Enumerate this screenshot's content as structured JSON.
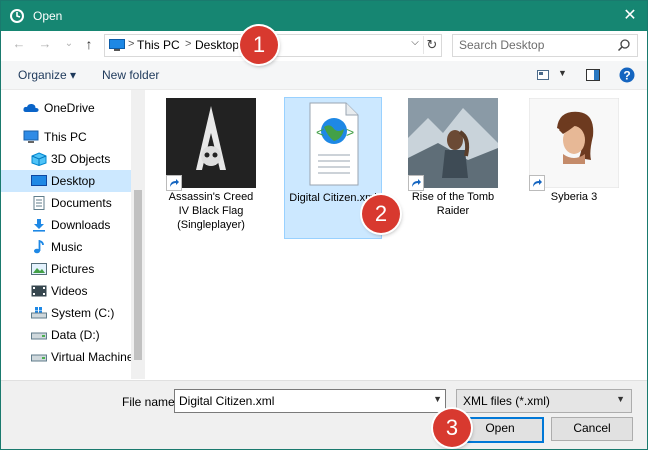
{
  "window": {
    "title": "Open",
    "close_glyph": "✕"
  },
  "nav_buttons": {
    "back": "←",
    "forward": "→",
    "recent": "⌄",
    "up": "↑"
  },
  "address": {
    "crumbs": [
      "This PC",
      "Desktop"
    ],
    "separator": ">",
    "dropdown": "⌵",
    "refresh": "↻"
  },
  "search": {
    "placeholder": "Search Desktop"
  },
  "toolbar": {
    "organize_label": "Organize ▾",
    "new_folder_label": "New folder",
    "view_dropdown": "▼"
  },
  "nav_pane": {
    "items": [
      {
        "label": "OneDrive",
        "icon": "cloud-icon"
      },
      {
        "label": "This PC",
        "icon": "computer-icon"
      },
      {
        "label": "3D Objects",
        "icon": "3d-objects-icon"
      },
      {
        "label": "Desktop",
        "icon": "desktop-icon",
        "selected": true
      },
      {
        "label": "Documents",
        "icon": "documents-icon"
      },
      {
        "label": "Downloads",
        "icon": "downloads-icon"
      },
      {
        "label": "Music",
        "icon": "music-icon"
      },
      {
        "label": "Pictures",
        "icon": "pictures-icon"
      },
      {
        "label": "Videos",
        "icon": "videos-icon"
      },
      {
        "label": "System (C:)",
        "icon": "drive-icon"
      },
      {
        "label": "Data (D:)",
        "icon": "drive-icon"
      },
      {
        "label": "Virtual Machines",
        "icon": "drive-icon"
      }
    ]
  },
  "files": [
    {
      "label": "Assassin's Creed IV Black Flag (Singleplayer)",
      "type": "shortcut"
    },
    {
      "label": "Digital Citizen.xml",
      "type": "xml",
      "selected": true
    },
    {
      "label": "Rise of the Tomb Raider",
      "type": "shortcut"
    },
    {
      "label": "Syberia 3",
      "type": "shortcut"
    }
  ],
  "bottom": {
    "file_name_label": "File name:",
    "file_name_value": "Digital Citizen.xml",
    "file_type_value": "XML files (*.xml)",
    "open_label": "Open",
    "cancel_label": "Cancel",
    "dropdown": "▼"
  },
  "callouts": [
    "1",
    "2",
    "3"
  ],
  "colors": {
    "titlebar": "#168672",
    "selection": "#cce8ff",
    "callout": "#d8392f",
    "accent": "#0078d7"
  }
}
